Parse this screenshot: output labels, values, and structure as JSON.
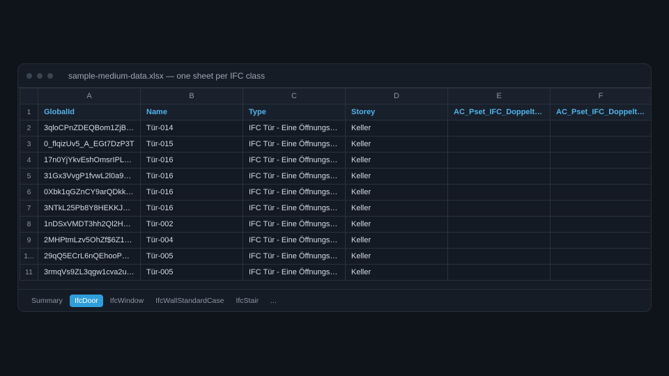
{
  "window": {
    "title": "sample-medium-data.xlsx — one sheet per IFC class"
  },
  "columns": [
    "A",
    "B",
    "C",
    "D",
    "E",
    "F"
  ],
  "rows": [
    {
      "num": "1",
      "cells": [
        "GlobalId",
        "Name",
        "Type",
        "Storey",
        "AC_Pset_IFC_Doppeltür_...",
        "AC_Pset_IFC_Doppeltür_..."
      ]
    },
    {
      "num": "2",
      "cells": [
        "3qloCPnZDEQBom1ZjBlwJP",
        "Tür-014",
        "IFC Tür - Eine Öffnungsgri...",
        "Keller",
        "",
        ""
      ]
    },
    {
      "num": "3",
      "cells": [
        "0_flqizUv5_A_EGt7DzP3T",
        "Tür-015",
        "IFC Tür - Eine Öffnungsgri...",
        "Keller",
        "",
        ""
      ]
    },
    {
      "num": "4",
      "cells": [
        "17n0YjYkvEshOmsrIPLGOb",
        "Tür-016",
        "IFC Tür - Eine Öffnungsgri...",
        "Keller",
        "",
        ""
      ]
    },
    {
      "num": "5",
      "cells": [
        "31Gx3VvgP1fvwL2l0a9YtY",
        "Tür-016",
        "IFC Tür - Eine Öffnungsgri...",
        "Keller",
        "",
        ""
      ]
    },
    {
      "num": "6",
      "cells": [
        "0Xbk1qGZnCY9arQDkkuJ...",
        "Tür-016",
        "IFC Tür - Eine Öffnungsgri...",
        "Keller",
        "",
        ""
      ]
    },
    {
      "num": "7",
      "cells": [
        "3NTkL25Pb8Y8HEKKJUt...",
        "Tür-016",
        "IFC Tür - Eine Öffnungsgri...",
        "Keller",
        "",
        ""
      ]
    },
    {
      "num": "8",
      "cells": [
        "1nDSxVMDT3hh2Ql2HEz...",
        "Tür-002",
        "IFC Tür - Eine Öffnungsgri...",
        "Keller",
        "",
        ""
      ]
    },
    {
      "num": "9",
      "cells": [
        "2MHPtmLzv5OhZf$6Z1Y...",
        "Tür-004",
        "IFC Tür - Eine Öffnungsgri...",
        "Keller",
        "",
        ""
      ]
    },
    {
      "num": "1...",
      "cells": [
        "29qQ5ECrL6nQEhooPP_...",
        "Tür-005",
        "IFC Tür - Eine Öffnungsgri...",
        "Keller",
        "",
        ""
      ]
    },
    {
      "num": "11",
      "cells": [
        "3rmqVs9ZL3qgw1cva2u9...",
        "Tür-005",
        "IFC Tür - Eine Öffnungsgri...",
        "Keller",
        "",
        ""
      ]
    }
  ],
  "tabs": [
    {
      "label": "Summary",
      "active": false
    },
    {
      "label": "IfcDoor",
      "active": true
    },
    {
      "label": "IfcWindow",
      "active": false
    },
    {
      "label": "IfcWallStandardCase",
      "active": false
    },
    {
      "label": "IfcStair",
      "active": false
    },
    {
      "label": "...",
      "active": false
    }
  ],
  "colors": {
    "accent": "#2f9fdb",
    "header_text": "#4fb3e8",
    "background": "#0f131a"
  }
}
